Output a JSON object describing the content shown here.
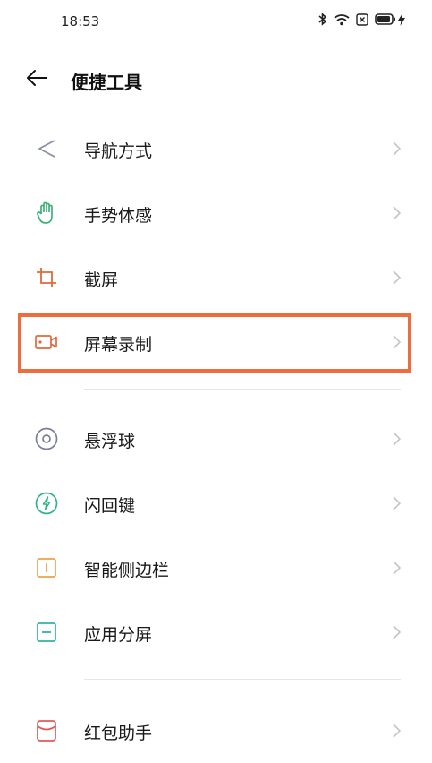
{
  "status_bar": {
    "time": "18:53",
    "icons": [
      "bluetooth-icon",
      "wifi-icon",
      "sim-icon",
      "battery-icon",
      "charging-icon"
    ]
  },
  "header": {
    "back_icon": "back-arrow-icon",
    "title": "便捷工具"
  },
  "items": [
    {
      "label": "导航方式",
      "icon": "navigation-icon",
      "color": "#8a8fa8"
    },
    {
      "label": "手势体感",
      "icon": "hand-gesture-icon",
      "color": "#3fb07a"
    },
    {
      "label": "截屏",
      "icon": "crop-icon",
      "color": "#e06a3a"
    },
    {
      "label": "屏幕录制",
      "icon": "video-camera-icon",
      "color": "#e06a3a"
    },
    {
      "label": "悬浮球",
      "icon": "floating-ball-icon",
      "color": "#7a7f9a"
    },
    {
      "label": "闪回键",
      "icon": "flashback-icon",
      "color": "#2fb58a"
    },
    {
      "label": "智能侧边栏",
      "icon": "sidebar-icon",
      "color": "#f0a04a"
    },
    {
      "label": "应用分屏",
      "icon": "split-screen-icon",
      "color": "#2fb5a0"
    },
    {
      "label": "红包助手",
      "icon": "red-envelope-icon",
      "color": "#e05a5a"
    }
  ],
  "highlight": {
    "target": "屏幕录制",
    "color": "#ef6c3c"
  }
}
